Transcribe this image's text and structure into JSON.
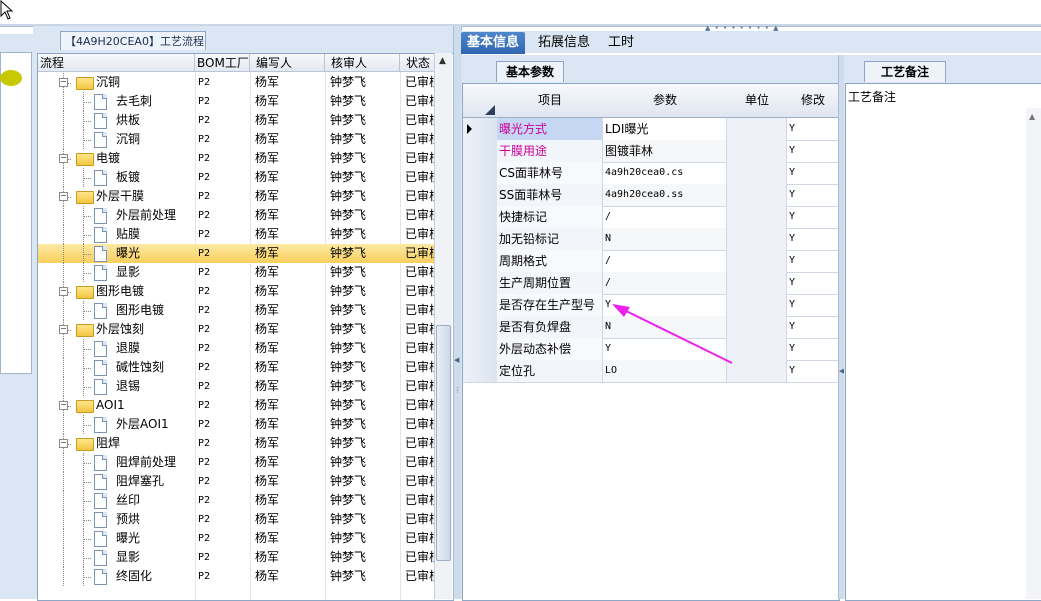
{
  "tree_tab": "【4A9H20CEA0】工艺流程",
  "tree_headers": {
    "name": "流程",
    "bom": "BOM工厂",
    "writer": "编写人",
    "reviewer": "核审人",
    "status": "状态"
  },
  "tree_rows": [
    {
      "name": "沉铜",
      "bom": "P2",
      "writer": "杨军",
      "reviewer": "钟梦飞",
      "status": "已审核",
      "type": "folder",
      "level": 0
    },
    {
      "name": "去毛刺",
      "bom": "P2",
      "writer": "杨军",
      "reviewer": "钟梦飞",
      "status": "已审核",
      "type": "doc",
      "level": 1
    },
    {
      "name": "烘板",
      "bom": "P2",
      "writer": "杨军",
      "reviewer": "钟梦飞",
      "status": "已审核",
      "type": "doc",
      "level": 1
    },
    {
      "name": "沉铜",
      "bom": "P2",
      "writer": "杨军",
      "reviewer": "钟梦飞",
      "status": "已审核",
      "type": "doc",
      "level": 1
    },
    {
      "name": "电镀",
      "bom": "P2",
      "writer": "杨军",
      "reviewer": "钟梦飞",
      "status": "已审核",
      "type": "folder",
      "level": 0
    },
    {
      "name": "板镀",
      "bom": "P2",
      "writer": "杨军",
      "reviewer": "钟梦飞",
      "status": "已审核",
      "type": "doc",
      "level": 1
    },
    {
      "name": "外层干膜",
      "bom": "P2",
      "writer": "杨军",
      "reviewer": "钟梦飞",
      "status": "已审核",
      "type": "folder",
      "level": 0
    },
    {
      "name": "外层前处理",
      "bom": "P2",
      "writer": "杨军",
      "reviewer": "钟梦飞",
      "status": "已审核",
      "type": "doc",
      "level": 1
    },
    {
      "name": "贴膜",
      "bom": "P2",
      "writer": "杨军",
      "reviewer": "钟梦飞",
      "status": "已审核",
      "type": "doc",
      "level": 1
    },
    {
      "name": "曝光",
      "bom": "P2",
      "writer": "杨军",
      "reviewer": "钟梦飞",
      "status": "已审核",
      "type": "doc",
      "level": 1,
      "selected": true
    },
    {
      "name": "显影",
      "bom": "P2",
      "writer": "杨军",
      "reviewer": "钟梦飞",
      "status": "已审核",
      "type": "doc",
      "level": 1
    },
    {
      "name": "图形电镀",
      "bom": "P2",
      "writer": "杨军",
      "reviewer": "钟梦飞",
      "status": "已审核",
      "type": "folder",
      "level": 0
    },
    {
      "name": "图形电镀",
      "bom": "P2",
      "writer": "杨军",
      "reviewer": "钟梦飞",
      "status": "已审核",
      "type": "doc",
      "level": 1
    },
    {
      "name": "外层蚀刻",
      "bom": "P2",
      "writer": "杨军",
      "reviewer": "钟梦飞",
      "status": "已审核",
      "type": "folder",
      "level": 0
    },
    {
      "name": "退膜",
      "bom": "P2",
      "writer": "杨军",
      "reviewer": "钟梦飞",
      "status": "已审核",
      "type": "doc",
      "level": 1
    },
    {
      "name": "碱性蚀刻",
      "bom": "P2",
      "writer": "杨军",
      "reviewer": "钟梦飞",
      "status": "已审核",
      "type": "doc",
      "level": 1
    },
    {
      "name": "退锡",
      "bom": "P2",
      "writer": "杨军",
      "reviewer": "钟梦飞",
      "status": "已审核",
      "type": "doc",
      "level": 1
    },
    {
      "name": "AOI1",
      "bom": "P2",
      "writer": "杨军",
      "reviewer": "钟梦飞",
      "status": "已审核",
      "type": "folder",
      "level": 0
    },
    {
      "name": "外层AOI1",
      "bom": "P2",
      "writer": "杨军",
      "reviewer": "钟梦飞",
      "status": "已审核",
      "type": "doc",
      "level": 1
    },
    {
      "name": "阻焊",
      "bom": "P2",
      "writer": "杨军",
      "reviewer": "钟梦飞",
      "status": "已审核",
      "type": "folder",
      "level": 0
    },
    {
      "name": "阻焊前处理",
      "bom": "P2",
      "writer": "杨军",
      "reviewer": "钟梦飞",
      "status": "已审核",
      "type": "doc",
      "level": 1
    },
    {
      "name": "阻焊塞孔",
      "bom": "P2",
      "writer": "杨军",
      "reviewer": "钟梦飞",
      "status": "已审核",
      "type": "doc",
      "level": 1
    },
    {
      "name": "丝印",
      "bom": "P2",
      "writer": "杨军",
      "reviewer": "钟梦飞",
      "status": "已审核",
      "type": "doc",
      "level": 1
    },
    {
      "name": "预烘",
      "bom": "P2",
      "writer": "杨军",
      "reviewer": "钟梦飞",
      "status": "已审核",
      "type": "doc",
      "level": 1
    },
    {
      "name": "曝光",
      "bom": "P2",
      "writer": "杨军",
      "reviewer": "钟梦飞",
      "status": "已审核",
      "type": "doc",
      "level": 1
    },
    {
      "name": "显影",
      "bom": "P2",
      "writer": "杨军",
      "reviewer": "钟梦飞",
      "status": "已审核",
      "type": "doc",
      "level": 1
    },
    {
      "name": "终固化",
      "bom": "P2",
      "writer": "杨军",
      "reviewer": "钟梦飞",
      "status": "已审核",
      "type": "doc",
      "level": 1
    }
  ],
  "right_tabs": [
    "基本信息",
    "拓展信息",
    "工时"
  ],
  "sub_tab": "基本参数",
  "param_headers": {
    "item": "项目",
    "param": "参数",
    "unit": "单位",
    "modify": "修改"
  },
  "param_rows": [
    {
      "item": "曝光方式",
      "param": "LDI曝光",
      "unit": "",
      "modify": "Y",
      "highlight": "pink",
      "current": true
    },
    {
      "item": "干膜用途",
      "param": "图镀菲林",
      "unit": "",
      "modify": "Y",
      "highlight": "pink"
    },
    {
      "item": "CS面菲林号",
      "param": "4a9h20cea0.cs",
      "unit": "",
      "modify": "Y",
      "mono": true
    },
    {
      "item": "SS面菲林号",
      "param": "4a9h20cea0.ss",
      "unit": "",
      "modify": "Y",
      "mono": true
    },
    {
      "item": "快捷标记",
      "param": "/",
      "unit": "",
      "modify": "Y"
    },
    {
      "item": "加无铅标记",
      "param": "N",
      "unit": "",
      "modify": "Y"
    },
    {
      "item": "周期格式",
      "param": "/",
      "unit": "",
      "modify": "Y"
    },
    {
      "item": "生产周期位置",
      "param": "/",
      "unit": "",
      "modify": "Y"
    },
    {
      "item": "是否存在生产型号",
      "param": "Y",
      "unit": "",
      "modify": "Y"
    },
    {
      "item": "是否有负焊盘",
      "param": "N",
      "unit": "",
      "modify": "Y"
    },
    {
      "item": "外层动态补偿",
      "param": "Y",
      "unit": "",
      "modify": "Y"
    },
    {
      "item": "定位孔",
      "param": "LO",
      "unit": "",
      "modify": "Y"
    }
  ],
  "notes_tab": "工艺备注",
  "notes_label": "工艺备注",
  "colors": {
    "pink_text": "#cc0099",
    "arrow": "#ee22ee",
    "accent": "#2f65b0",
    "select": "#f8cf5e"
  }
}
